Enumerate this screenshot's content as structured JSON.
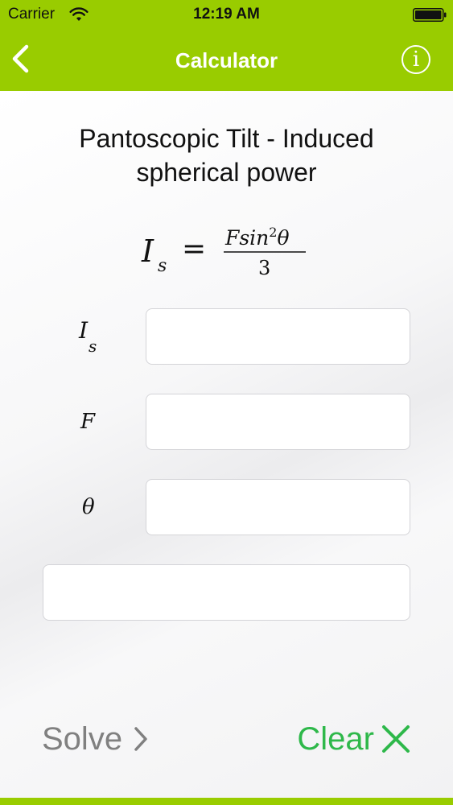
{
  "status_bar": {
    "carrier": "Carrier",
    "time": "12:19 AM"
  },
  "nav": {
    "title": "Calculator",
    "info_glyph": "i"
  },
  "page": {
    "title": "Pantoscopic Tilt - Induced spherical power"
  },
  "formula": {
    "lhs_symbol": "I",
    "lhs_subscript": "s",
    "equals": "=",
    "numerator": "Fsin",
    "numerator_exponent": "2",
    "numerator_variable": "θ",
    "denominator": "3"
  },
  "fields": {
    "is_label": "I",
    "is_label_subscript": "s",
    "is_value": "",
    "f_label": "F",
    "f_value": "",
    "theta_label": "θ",
    "theta_value": "",
    "result_value": ""
  },
  "actions": {
    "solve_label": "Solve",
    "clear_label": "Clear"
  },
  "colors": {
    "brand": "#99cc00",
    "clear": "#2eb84a",
    "solve": "#808080"
  },
  "icons": {
    "back": "chevron-left-icon",
    "info": "info-icon",
    "solve": "chevron-right-icon",
    "clear": "close-icon",
    "wifi": "wifi-icon",
    "battery": "battery-icon"
  }
}
